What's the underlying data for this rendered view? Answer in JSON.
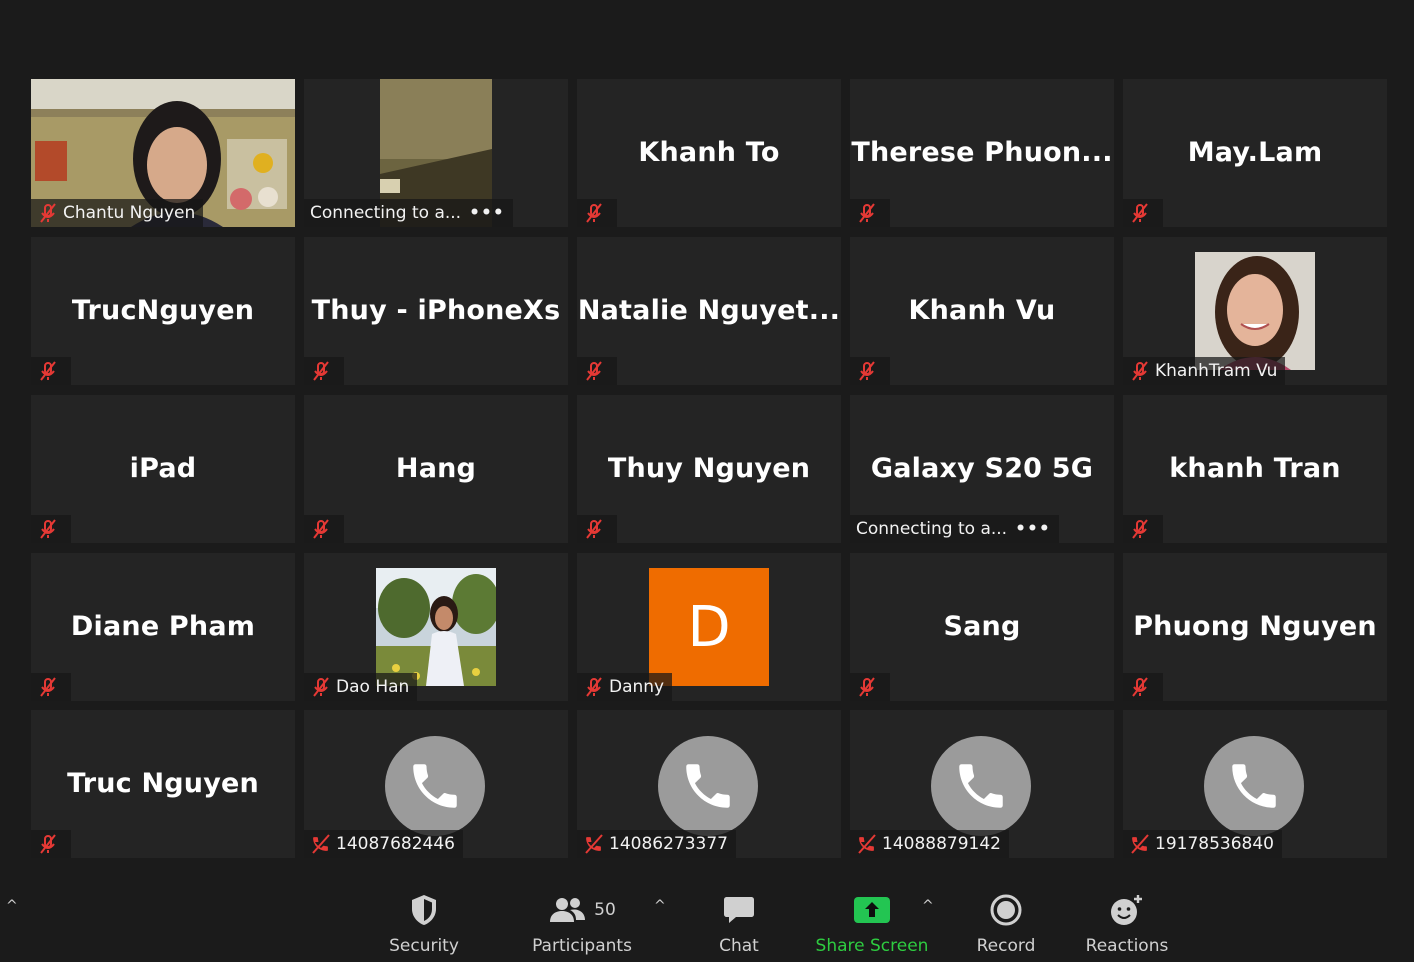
{
  "tiles": [
    {
      "name": "Chantu Nguyen"
    },
    {
      "status": "Connecting to a...",
      "dots": "•••"
    },
    {
      "name": "Khanh To"
    },
    {
      "name": "Therese  Phuon..."
    },
    {
      "name": "May.Lam"
    },
    {
      "name": "TrucNguyen"
    },
    {
      "name": "Thuy - iPhoneXs"
    },
    {
      "name": "Natalie  Nguyet..."
    },
    {
      "name": "Khanh Vu"
    },
    {
      "name": "KhanhTram Vu"
    },
    {
      "name": "iPad"
    },
    {
      "name": "Hang"
    },
    {
      "name": "Thuy Nguyen"
    },
    {
      "name": "Galaxy S20 5G",
      "status": "Connecting to a...",
      "dots": "•••"
    },
    {
      "name": "khanh Tran"
    },
    {
      "name": "Diane Pham"
    },
    {
      "name": "Dao Han"
    },
    {
      "name": "Danny",
      "initial": "D"
    },
    {
      "name": "Sang"
    },
    {
      "name": "Phuong Nguyen"
    },
    {
      "name": "Truc Nguyen"
    },
    {
      "name": "14087682446"
    },
    {
      "name": "14086273377"
    },
    {
      "name": "14088879142"
    },
    {
      "name": "19178536840"
    }
  ],
  "toolbar": {
    "security": "Security",
    "participants": "Participants",
    "participants_count": "50",
    "chat": "Chat",
    "share_screen": "Share Screen",
    "record": "Record",
    "reactions": "Reactions",
    "caret": "^"
  },
  "colors": {
    "tile_bg": "#242424",
    "avatar_orange": "#ef6c00",
    "share_green": "#23c552",
    "mute_red": "#e53935",
    "phone_gray": "#9b9b9b"
  }
}
